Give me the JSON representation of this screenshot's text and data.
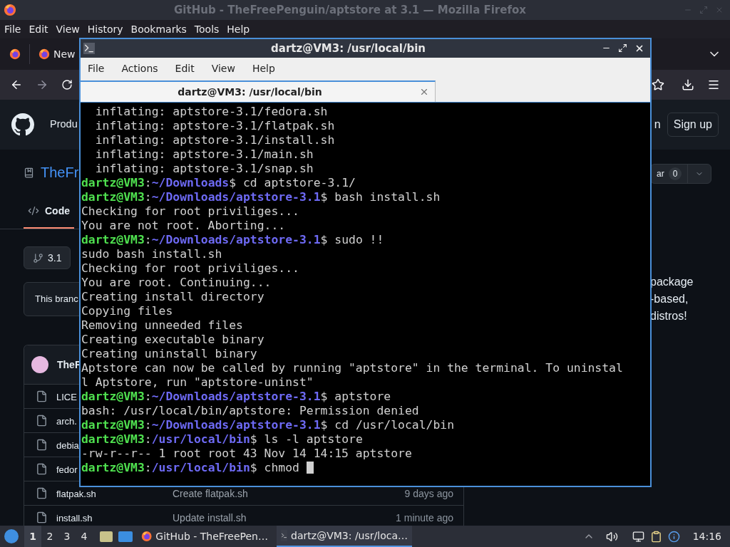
{
  "firefox": {
    "title": "GitHub - TheFreePenguin/aptstore at 3.1 — Mozilla Firefox",
    "menu": [
      "File",
      "Edit",
      "View",
      "History",
      "Bookmarks",
      "Tools",
      "Help"
    ],
    "tab": {
      "label": "New"
    }
  },
  "github": {
    "header_left": "Produ",
    "header_right": "n",
    "sign_up": "Sign up",
    "repo_name": "TheFr",
    "tabs": [
      {
        "label": "Code",
        "selected": true
      }
    ],
    "branch": "3.1",
    "banner": "This branc",
    "author": "TheF",
    "files": [
      {
        "name": "LICE"
      },
      {
        "name": "arch."
      },
      {
        "name": "debia"
      },
      {
        "name": "fedor"
      },
      {
        "name": "flatpak.sh",
        "message": "Create flatpak.sh",
        "time": "9 days ago"
      },
      {
        "name": "install.sh",
        "message": "Update install.sh",
        "time": "1 minute ago"
      }
    ],
    "star_label": "ar",
    "star_count": "0",
    "about": [
      "package",
      "-based,",
      "distros!"
    ]
  },
  "terminal": {
    "title": "dartz@VM3: /usr/local/bin",
    "menu": [
      "File",
      "Actions",
      "Edit",
      "View",
      "Help"
    ],
    "tabs": [
      {
        "label": "dartz@VM3: /usr/local/bin",
        "selected": true
      }
    ],
    "lines": [
      {
        "kind": "output",
        "text": "  inflating: aptstore-3.1/fedora.sh"
      },
      {
        "kind": "output",
        "text": "  inflating: aptstore-3.1/flatpak.sh"
      },
      {
        "kind": "output",
        "text": "  inflating: aptstore-3.1/install.sh"
      },
      {
        "kind": "output",
        "text": "  inflating: aptstore-3.1/main.sh"
      },
      {
        "kind": "output",
        "text": "  inflating: aptstore-3.1/snap.sh"
      },
      {
        "kind": "prompt",
        "user": "dartz@VM3",
        "sep": ":",
        "path": "~/Downloads",
        "sign": "$",
        "command": "cd aptstore-3.1/"
      },
      {
        "kind": "prompt",
        "user": "dartz@VM3",
        "sep": ":",
        "path": "~/Downloads/aptstore-3.1",
        "sign": "$",
        "command": "bash install.sh"
      },
      {
        "kind": "output",
        "text": "Checking for root priviliges..."
      },
      {
        "kind": "output",
        "text": "You are not root. Aborting..."
      },
      {
        "kind": "prompt",
        "user": "dartz@VM3",
        "sep": ":",
        "path": "~/Downloads/aptstore-3.1",
        "sign": "$",
        "command": "sudo !!"
      },
      {
        "kind": "output",
        "text": "sudo bash install.sh"
      },
      {
        "kind": "output",
        "text": "Checking for root priviliges..."
      },
      {
        "kind": "output",
        "text": "You are root. Continuing..."
      },
      {
        "kind": "output",
        "text": "Creating install directory"
      },
      {
        "kind": "output",
        "text": "Copying files"
      },
      {
        "kind": "output",
        "text": "Removing unneeded files"
      },
      {
        "kind": "output",
        "text": "Creating executable binary"
      },
      {
        "kind": "output",
        "text": "Creating uninstall binary"
      },
      {
        "kind": "output",
        "text": "Aptstore can now be called by running \"aptstore\" in the terminal. To uninstal"
      },
      {
        "kind": "output",
        "text": "l Aptstore, run \"aptstore-uninst\""
      },
      {
        "kind": "prompt",
        "user": "dartz@VM3",
        "sep": ":",
        "path": "~/Downloads/aptstore-3.1",
        "sign": "$",
        "command": "aptstore"
      },
      {
        "kind": "output",
        "text": "bash: /usr/local/bin/aptstore: Permission denied"
      },
      {
        "kind": "prompt",
        "user": "dartz@VM3",
        "sep": ":",
        "path": "~/Downloads/aptstore-3.1",
        "sign": "$",
        "command": "cd /usr/local/bin"
      },
      {
        "kind": "prompt",
        "user": "dartz@VM3",
        "sep": ":",
        "path": "/usr/local/bin",
        "sign": "$",
        "command": "ls -l aptstore"
      },
      {
        "kind": "output",
        "text": "-rw-r--r-- 1 root root 43 Nov 14 14:15 aptstore"
      },
      {
        "kind": "prompt",
        "user": "dartz@VM3",
        "sep": ":",
        "path": "/usr/local/bin",
        "sign": "$",
        "command": "chmod ",
        "cursor": true
      }
    ]
  },
  "taskbar": {
    "workspaces": [
      {
        "label": "1",
        "selected": true
      },
      {
        "label": "2",
        "selected": false
      },
      {
        "label": "3",
        "selected": false
      },
      {
        "label": "4",
        "selected": false
      }
    ],
    "tasks": [
      {
        "label": "GitHub - TheFreePen…",
        "selected": false
      },
      {
        "label": "dartz@VM3: /usr/loca…",
        "selected": true
      }
    ],
    "clock": "14:16"
  }
}
